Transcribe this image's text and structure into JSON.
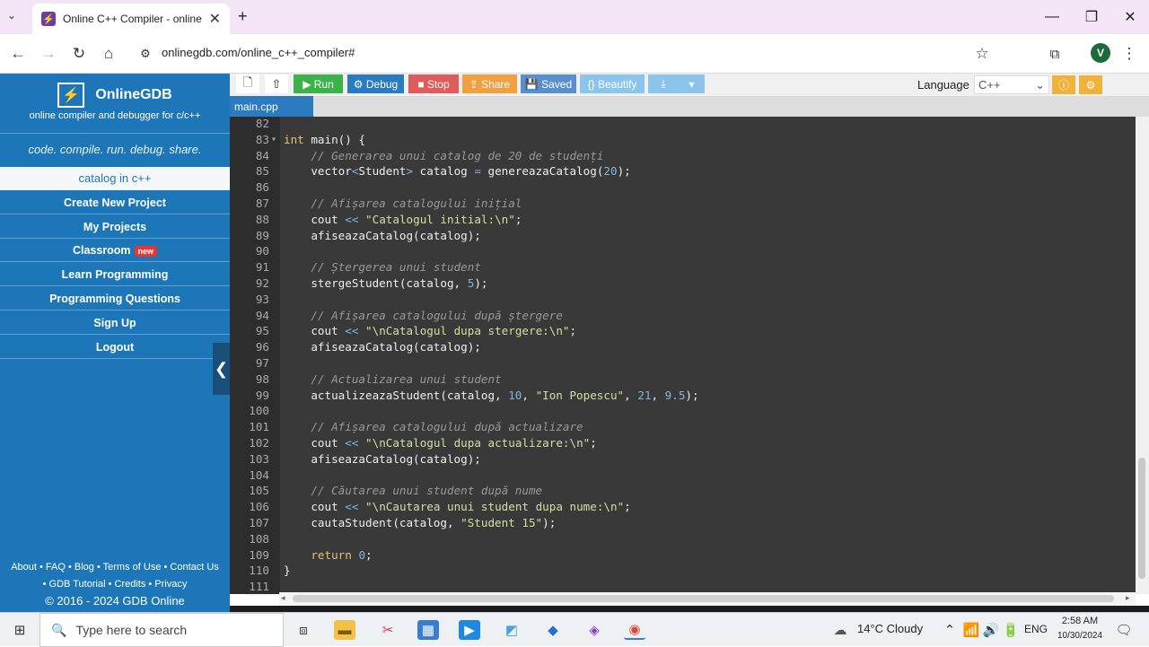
{
  "browser": {
    "tab_title": "Online C++ Compiler - online",
    "tab_close": "✕",
    "new_tab": "+",
    "url": "onlinegdb.com/online_c++_compiler#",
    "profile_initial": "V",
    "window": {
      "minimize": "—",
      "maximize": "❐",
      "close": "✕"
    }
  },
  "sidebar": {
    "brand": "OnlineGDB",
    "subtitle": "online compiler and debugger for c/c++",
    "tagline": "code. compile. run. debug. share.",
    "current_project": "catalog in c++",
    "menu": [
      {
        "label": "Create New Project"
      },
      {
        "label": "My Projects"
      },
      {
        "label": "Classroom",
        "badge": "new"
      },
      {
        "label": "Learn Programming"
      },
      {
        "label": "Programming Questions"
      },
      {
        "label": "Sign Up"
      },
      {
        "label": "Logout"
      }
    ],
    "footer_line1": "About • FAQ • Blog • Terms of Use • Contact Us",
    "footer_line2": "• GDB Tutorial • Credits • Privacy",
    "footer_line3": "© 2016 - 2024 GDB Online"
  },
  "toolbar": {
    "run": "▶ Run",
    "debug": "⚙ Debug",
    "stop": "■ Stop",
    "share": "⇪ Share",
    "saved": "💾 Saved",
    "beautify": "{} Beautify",
    "download": "⤓",
    "download_more": "▾",
    "language_label": "Language",
    "language_value": "C++",
    "colors": {
      "run": "#3cb34a",
      "debug": "#2a7bc0",
      "stop": "#e05b5b",
      "share": "#f0a040",
      "saved": "#5a8fcf",
      "beautify": "#8cc5ec",
      "download": "#8cc5ec",
      "aux": "#f0b23a"
    }
  },
  "editor": {
    "file_tab": "main.cpp",
    "line_numbers": [
      "82",
      "83",
      "84",
      "85",
      "86",
      "87",
      "88",
      "89",
      "90",
      "91",
      "92",
      "93",
      "94",
      "95",
      "96",
      "97",
      "98",
      "99",
      "100",
      "101",
      "102",
      "103",
      "104",
      "105",
      "106",
      "107",
      "108",
      "109",
      "110",
      "111"
    ]
  },
  "taskbar": {
    "search_placeholder": "Type here to search",
    "weather": "14°C  Cloudy",
    "language": "ENG",
    "time": "2:58 AM",
    "date": "10/30/2024"
  }
}
